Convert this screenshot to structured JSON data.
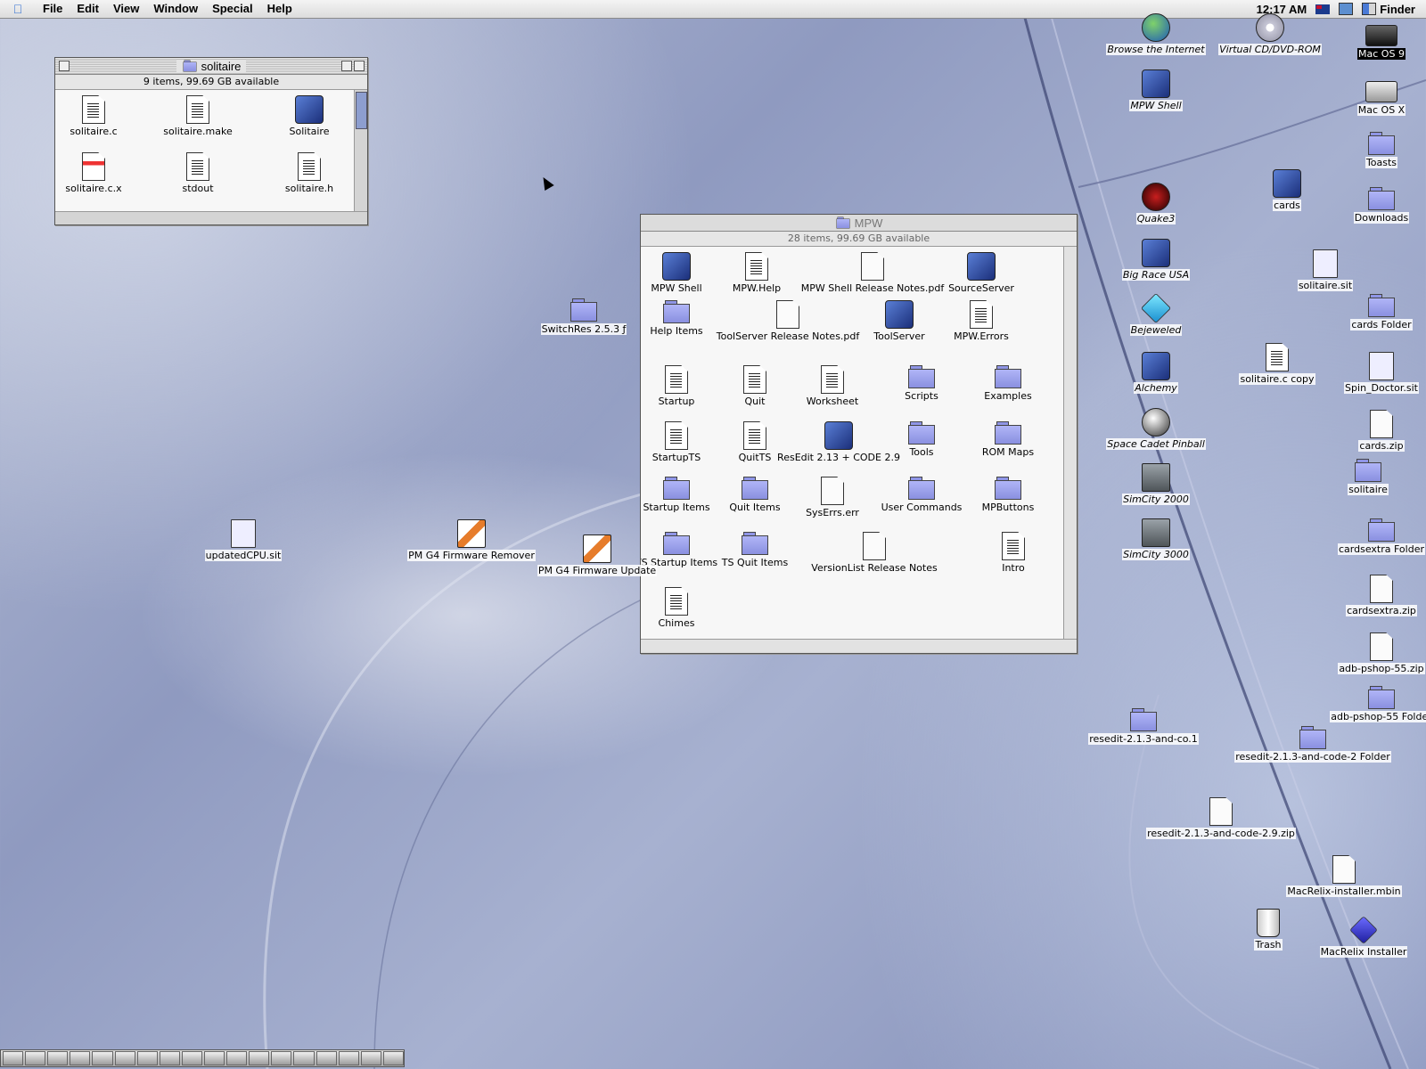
{
  "menubar": {
    "items": [
      "File",
      "Edit",
      "View",
      "Window",
      "Special",
      "Help"
    ],
    "clock": "12:17 AM",
    "app_name": "Finder"
  },
  "solitaire_window": {
    "title": "solitaire",
    "info": "9 items, 99.69 GB available",
    "items": [
      {
        "label": "solitaire.c",
        "icon": "text-document-icon"
      },
      {
        "label": "solitaire.make",
        "icon": "text-document-icon"
      },
      {
        "label": "Solitaire",
        "icon": "application-icon"
      },
      {
        "label": "solitaire.c.x",
        "icon": "xcoff-document-icon"
      },
      {
        "label": "stdout",
        "icon": "text-document-icon"
      },
      {
        "label": "solitaire.h",
        "icon": "text-document-icon"
      }
    ]
  },
  "mpw_window": {
    "title": "MPW",
    "info": "28 items, 99.69 GB available",
    "items": [
      {
        "label": "MPW Shell",
        "icon": "application-icon"
      },
      {
        "label": "MPW.Help",
        "icon": "text-document-icon"
      },
      {
        "label": "MPW Shell Release Notes.pdf",
        "icon": "pdf-document-icon"
      },
      {
        "label": "SourceServer",
        "icon": "application-icon"
      },
      {
        "label": "Help Items",
        "icon": "folder-icon"
      },
      {
        "label": "ToolServer Release Notes.pdf",
        "icon": "pdf-document-icon"
      },
      {
        "label": "ToolServer",
        "icon": "application-icon"
      },
      {
        "label": "MPW.Errors",
        "icon": "text-document-icon"
      },
      {
        "label": "Startup",
        "icon": "text-document-icon"
      },
      {
        "label": "Quit",
        "icon": "text-document-icon"
      },
      {
        "label": "Worksheet",
        "icon": "text-document-icon"
      },
      {
        "label": "Scripts",
        "icon": "folder-icon"
      },
      {
        "label": "Examples",
        "icon": "folder-icon"
      },
      {
        "label": "StartupTS",
        "icon": "text-document-icon"
      },
      {
        "label": "QuitTS",
        "icon": "text-document-icon"
      },
      {
        "label": "ResEdit 2.13 + CODE 2.9",
        "icon": "application-icon"
      },
      {
        "label": "Tools",
        "icon": "folder-icon"
      },
      {
        "label": "ROM Maps",
        "icon": "folder-icon"
      },
      {
        "label": "Startup Items",
        "icon": "folder-icon"
      },
      {
        "label": "Quit Items",
        "icon": "folder-icon"
      },
      {
        "label": "SysErrs.err",
        "icon": "document-icon"
      },
      {
        "label": "User Commands",
        "icon": "folder-icon"
      },
      {
        "label": "MPButtons",
        "icon": "folder-icon"
      },
      {
        "label": "TS Startup Items",
        "icon": "folder-icon"
      },
      {
        "label": "TS Quit Items",
        "icon": "folder-icon"
      },
      {
        "label": "VersionList Release Notes",
        "icon": "document-icon"
      },
      {
        "label": "Intro",
        "icon": "text-document-icon"
      },
      {
        "label": "Chimes",
        "icon": "text-document-icon"
      }
    ]
  },
  "desktop_icons": [
    {
      "label": "Browse the Internet",
      "icon": "globe-icon"
    },
    {
      "label": "Virtual CD/DVD-ROM",
      "icon": "cd-icon"
    },
    {
      "label": "Mac OS 9",
      "icon": "hard-disk-icon"
    },
    {
      "label": "MPW Shell",
      "icon": "application-icon"
    },
    {
      "label": "Mac OS X",
      "icon": "hard-disk-icon"
    },
    {
      "label": "Toasts",
      "icon": "folder-icon"
    },
    {
      "label": "Quake3",
      "icon": "quake-icon"
    },
    {
      "label": "cards",
      "icon": "application-icon"
    },
    {
      "label": "Downloads",
      "icon": "folder-icon"
    },
    {
      "label": "Big Race USA",
      "icon": "game-icon"
    },
    {
      "label": "solitaire.sit",
      "icon": "stuffit-archive-icon"
    },
    {
      "label": "Bejeweled",
      "icon": "gem-icon"
    },
    {
      "label": "cards Folder",
      "icon": "folder-icon"
    },
    {
      "label": "Alchemy",
      "icon": "game-icon"
    },
    {
      "label": "solitaire.c copy",
      "icon": "text-document-icon"
    },
    {
      "label": "Spin_Doctor.sit",
      "icon": "stuffit-archive-icon"
    },
    {
      "label": "Space Cadet Pinball",
      "icon": "pinball-icon"
    },
    {
      "label": "cards.zip",
      "icon": "document-icon"
    },
    {
      "label": "SimCity 2000",
      "icon": "city-icon"
    },
    {
      "label": "solitaire",
      "icon": "folder-icon"
    },
    {
      "label": "SimCity 3000",
      "icon": "city-icon"
    },
    {
      "label": "cardsextra Folder",
      "icon": "folder-icon"
    },
    {
      "label": "cardsextra.zip",
      "icon": "document-icon"
    },
    {
      "label": "adb-pshop-55.zip",
      "icon": "document-icon"
    },
    {
      "label": "adb-pshop-55 Folder",
      "icon": "folder-icon"
    },
    {
      "label": "resedit-2.1.3-and-co.1",
      "icon": "folder-icon"
    },
    {
      "label": "resedit-2.1.3-and-code-2 Folder",
      "icon": "folder-icon"
    },
    {
      "label": "resedit-2.1.3-and-code-2.9.zip",
      "icon": "document-icon"
    },
    {
      "label": "MacRelix-installer.mbin",
      "icon": "document-icon"
    },
    {
      "label": "Trash",
      "icon": "trash-icon"
    },
    {
      "label": "MacRelix Installer",
      "icon": "installer-icon"
    },
    {
      "label": "SwitchRes 2.5.3 ƒ",
      "icon": "folder-icon"
    },
    {
      "label": "updatedCPU.sit",
      "icon": "stuffit-archive-icon"
    },
    {
      "label": "PM G4 Firmware Remover",
      "icon": "firmware-icon"
    },
    {
      "label": "PM G4 Firmware Update",
      "icon": "firmware-icon"
    }
  ]
}
